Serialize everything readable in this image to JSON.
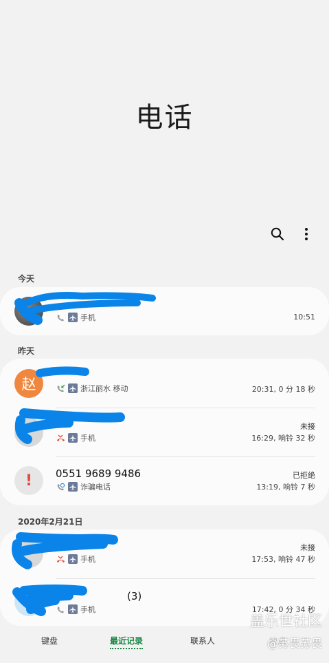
{
  "header": {
    "title": "电话"
  },
  "toolbar": {
    "search_icon": "search-icon",
    "more_icon": "more-vertical-icon"
  },
  "sections": {
    "today": "今天",
    "yesterday": "昨天",
    "feb21": "2020年2月21日"
  },
  "calls": [
    {
      "name": "",
      "type_icon": "outgoing-call-icon",
      "sim_icon": "airplane-icon",
      "label": "手机",
      "time": "10:51",
      "status": ""
    },
    {
      "name": "",
      "avatar_text": "赵",
      "type_icon": "incoming-call-icon",
      "sim_icon": "airplane-icon",
      "label": "浙江丽水 移动",
      "time": "20:31, 0 分 18 秒",
      "status": ""
    },
    {
      "name": "",
      "type_icon": "missed-call-icon",
      "sim_icon": "airplane-icon",
      "label": "手机",
      "time": "16:29, 响铃 32 秒",
      "status": "未接"
    },
    {
      "name": "0551 9689 9486",
      "avatar_text": "!",
      "type_icon": "rejected-call-icon",
      "sim_icon": "airplane-icon",
      "label": "诈骗电话",
      "time": "13:19, 响铃 7 秒",
      "status": "已拒绝"
    },
    {
      "name": "",
      "type_icon": "missed-call-icon",
      "sim_icon": "airplane-icon",
      "label": "手机",
      "time": "17:53, 响铃 47 秒",
      "status": "未接"
    },
    {
      "name": "(3)",
      "type_icon": "outgoing-call-icon",
      "sim_icon": "airplane-icon",
      "label": "手机",
      "time": "17:42, 0 分 34 秒",
      "status": ""
    }
  ],
  "bottom_nav": {
    "keypad": "键盘",
    "recents": "最近记录",
    "contacts": "联系人",
    "places": "地点"
  },
  "watermark": {
    "line1": "盖乐世社区",
    "line2": "@苏畏苏畏"
  },
  "colors": {
    "accent": "#14853f",
    "avatar_orange": "#f0873f",
    "missed_red": "#e24a3b",
    "scribble_blue": "#0a84e8"
  }
}
